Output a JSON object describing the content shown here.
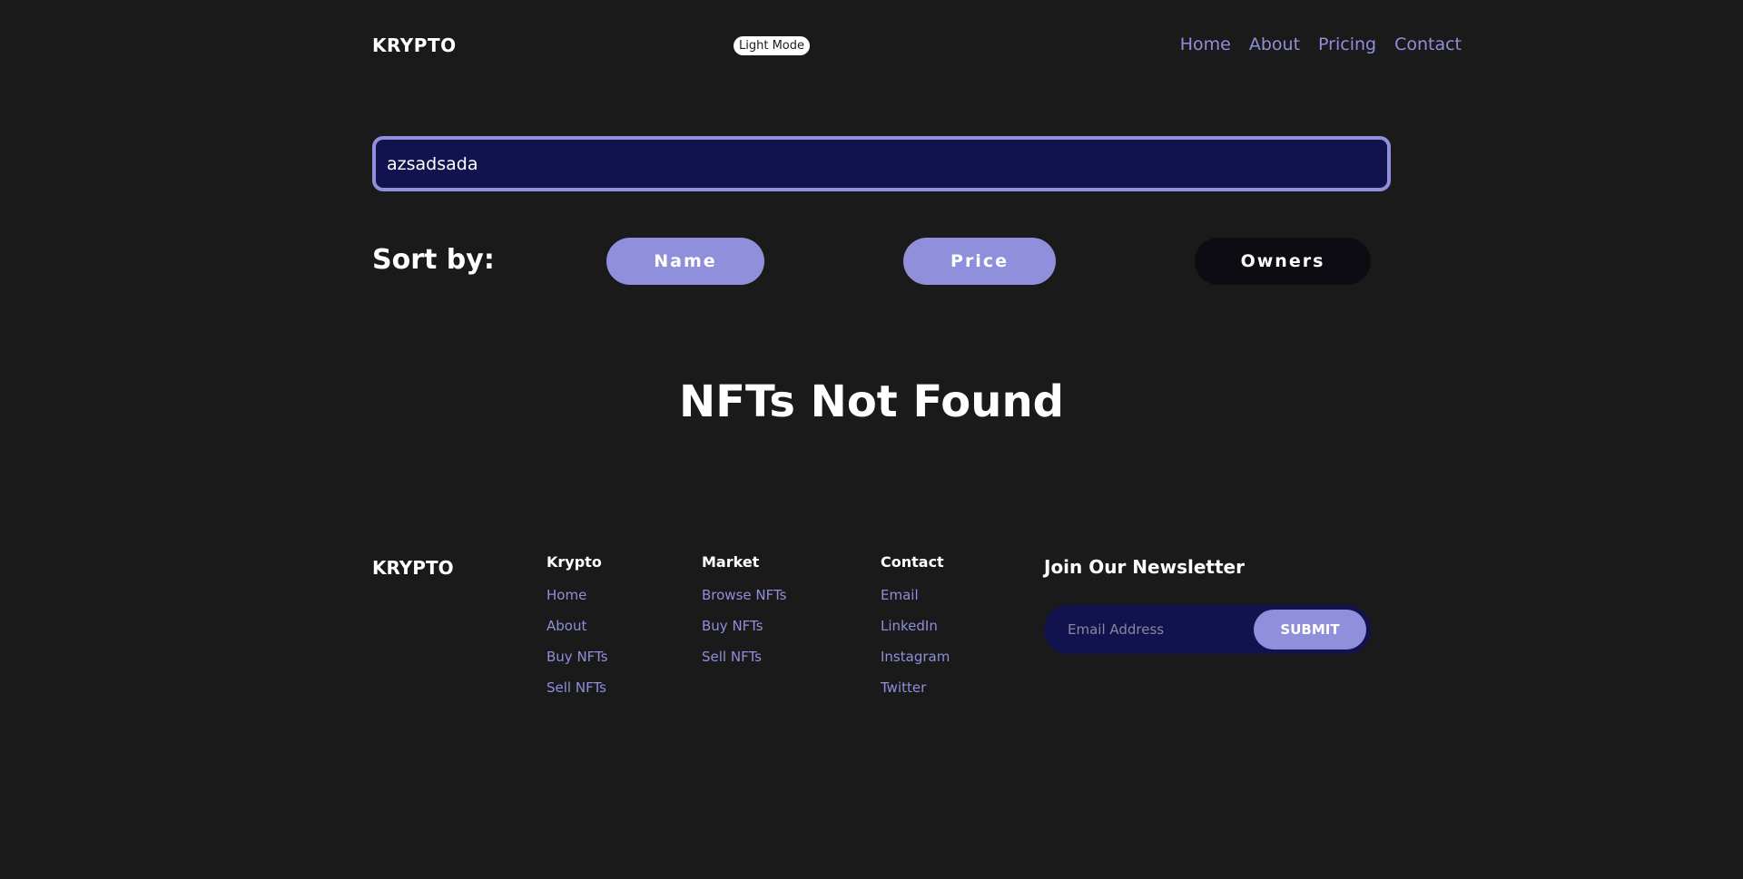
{
  "header": {
    "logo": "KRYPTO",
    "mode_toggle": "Light Mode",
    "nav": [
      "Home",
      "About",
      "Pricing",
      "Contact"
    ]
  },
  "search": {
    "value": "azsadsada"
  },
  "sort": {
    "label": "Sort by:",
    "options": [
      "Name",
      "Price",
      "Owners"
    ]
  },
  "empty_state": {
    "title": "NFTs Not Found"
  },
  "footer": {
    "logo": "KRYPTO",
    "columns": [
      {
        "title": "Krypto",
        "links": [
          "Home",
          "About",
          "Buy NFTs",
          "Sell NFTs"
        ]
      },
      {
        "title": "Market",
        "links": [
          "Browse NFTs",
          "Buy NFTs",
          "Sell NFTs"
        ]
      },
      {
        "title": "Contact",
        "links": [
          "Email",
          "LinkedIn",
          "Instagram",
          "Twitter"
        ]
      }
    ],
    "newsletter": {
      "title": "Join Our Newsletter",
      "placeholder": "Email Address",
      "submit": "SUBMIT"
    }
  },
  "colors": {
    "background": "#1a1a1a",
    "accent": "#8f8fdb",
    "input_bg": "#12124e",
    "dark_button": "#0c0c12"
  }
}
